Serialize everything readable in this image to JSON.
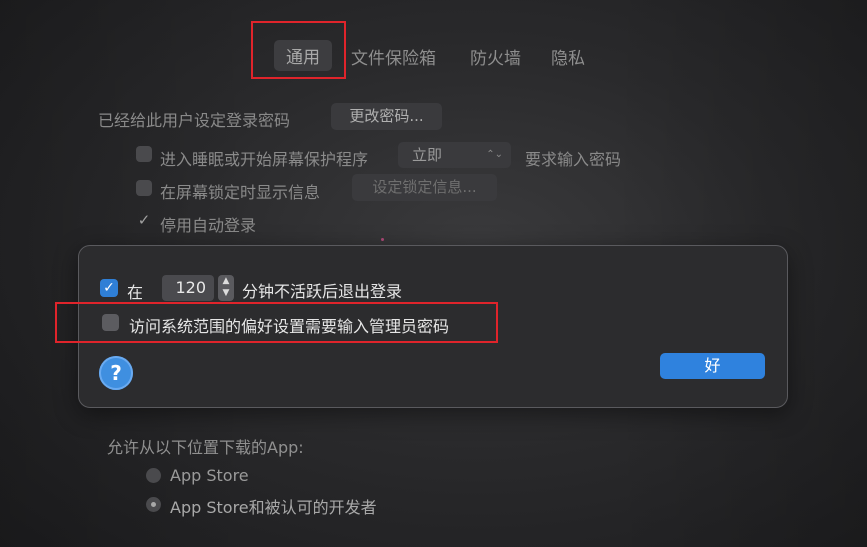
{
  "tabs": [
    "通用",
    "文件保险箱",
    "防火墙",
    "隐私"
  ],
  "password": {
    "label": "已经给此用户设定登录密码",
    "change_button": "更改密码..."
  },
  "sleep_option": {
    "label": "进入睡眠或开始屏幕保护程序",
    "select_value": "立即",
    "suffix": "要求输入密码"
  },
  "lock_message": {
    "label": "在屏幕锁定时显示信息",
    "button": "设定锁定信息..."
  },
  "auto_login": {
    "label": "停用自动登录"
  },
  "sheet": {
    "logout_prefix": "在",
    "logout_minutes": "120",
    "logout_suffix": "分钟不活跃后退出登录",
    "admin_label": "访问系统范围的偏好设置需要输入管理员密码",
    "help": "?",
    "ok": "好"
  },
  "downloads": {
    "label": "允许从以下位置下载的App:",
    "options": [
      "App Store",
      "App Store和被认可的开发者"
    ]
  },
  "colors": {
    "accent": "#2f82de",
    "highlight": "#e0242b"
  }
}
